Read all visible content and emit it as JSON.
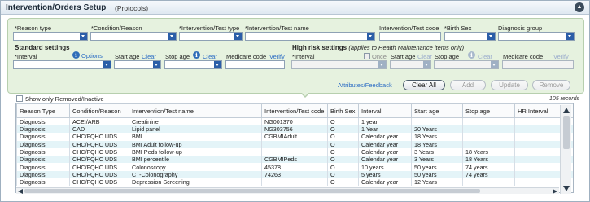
{
  "title": "Intervention/Orders Setup",
  "subtitle": "(Protocols)",
  "criteria": {
    "reason_type": "*Reason type",
    "condition_reason": "*Condition/Reason",
    "intervention_test_type": "*Intervention/Test type",
    "intervention_test_name": "*Intervention/Test name",
    "intervention_test_code": "Intervention/Test code",
    "birth_sex": "*Birth Sex",
    "diagnosis_group": "Diagnosis group"
  },
  "standard": {
    "heading": "Standard settings",
    "interval": "*Interval",
    "options": "Options",
    "start_age": "Start age",
    "clear1": "Clear",
    "stop_age": "Stop age",
    "clear2": "Clear",
    "medicare_code": "Medicare code",
    "verify": "Verify"
  },
  "high_risk": {
    "heading": "High risk settings",
    "note": "(applies to Health Maintenance items only)",
    "interval": "*Interval",
    "once": "Once",
    "start_age": "Start age",
    "clear1": "Clear",
    "stop_age": "Stop age",
    "clear2": "Clear",
    "medicare_code": "Medicare code",
    "verify": "Verify"
  },
  "actions": {
    "attributes_feedback": "Attributes/Feedback",
    "clear_all": "Clear All",
    "add": "Add",
    "update": "Update",
    "remove": "Remove"
  },
  "show_removed": "Show only Removed/Inactive",
  "records": "105 records",
  "grid": {
    "columns": [
      "Reason Type",
      "Condition/Reason",
      "Intervention/Test name",
      "Intervention/Test code",
      "Birth Sex",
      "Interval",
      "Start age",
      "Stop age",
      "HR Interval"
    ],
    "rows": [
      [
        "Diagnosis",
        "ACEI/ARB",
        "Creatinine",
        "NG001370",
        "O",
        "1 year",
        "",
        "",
        ""
      ],
      [
        "Diagnosis",
        "CAD",
        "Lipid panel",
        "NG303756",
        "O",
        "1 Year",
        "20 Years",
        "",
        ""
      ],
      [
        "Diagnosis",
        "CHC/FQHC UDS",
        "BMI",
        "CGBMIAdult",
        "O",
        "Calendar year",
        "18 Years",
        "",
        ""
      ],
      [
        "Diagnosis",
        "CHC/FQHC UDS",
        "BMI Adult follow-up",
        "",
        "O",
        "Calendar year",
        "18 Years",
        "",
        ""
      ],
      [
        "Diagnosis",
        "CHC/FQHC UDS",
        "BMI Peds follow-up",
        "",
        "O",
        "Calendar year",
        "3 Years",
        "18 Years",
        ""
      ],
      [
        "Diagnosis",
        "CHC/FQHC UDS",
        "BMI percentile",
        "CGBMIPeds",
        "O",
        "Calendar year",
        "3 Years",
        "18 Years",
        ""
      ],
      [
        "Diagnosis",
        "CHC/FQHC UDS",
        "Colonoscopy",
        "45378",
        "O",
        "10 years",
        "50 years",
        "74 years",
        ""
      ],
      [
        "Diagnosis",
        "CHC/FQHC UDS",
        "CT-Colonography",
        "74263",
        "O",
        "5 years",
        "50 years",
        "74 years",
        ""
      ],
      [
        "Diagnosis",
        "CHC/FQHC UDS",
        "Depression Screening",
        "",
        "O",
        "Calendar year",
        "12 Years",
        "",
        ""
      ]
    ]
  }
}
